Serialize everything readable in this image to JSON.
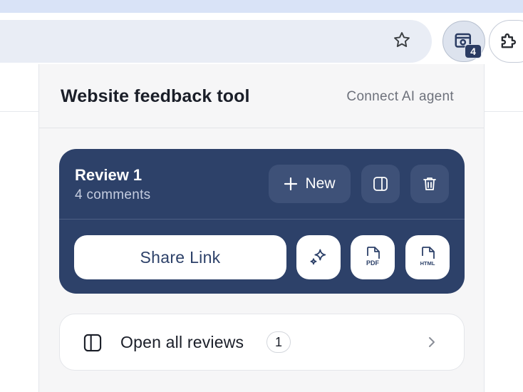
{
  "extension": {
    "badge_count": "4"
  },
  "popup": {
    "title": "Website feedback tool",
    "connect_link": "Connect AI agent",
    "review": {
      "title": "Review 1",
      "subtitle": "4 comments",
      "new_label": "New",
      "share_label": "Share Link",
      "pdf_label": "PDF",
      "html_label": "HTML"
    },
    "open_all": {
      "label": "Open all reviews",
      "count": "1"
    }
  },
  "colors": {
    "card_bg": "#2d4169",
    "accent": "#2b3c63"
  },
  "icons": [
    "star-icon",
    "extension-feedback-icon",
    "puzzle-icon",
    "plus-icon",
    "sidebar-panel-icon",
    "trash-icon",
    "sparkle-icon",
    "pdf-file-icon",
    "html-file-icon",
    "chevron-right-icon"
  ]
}
